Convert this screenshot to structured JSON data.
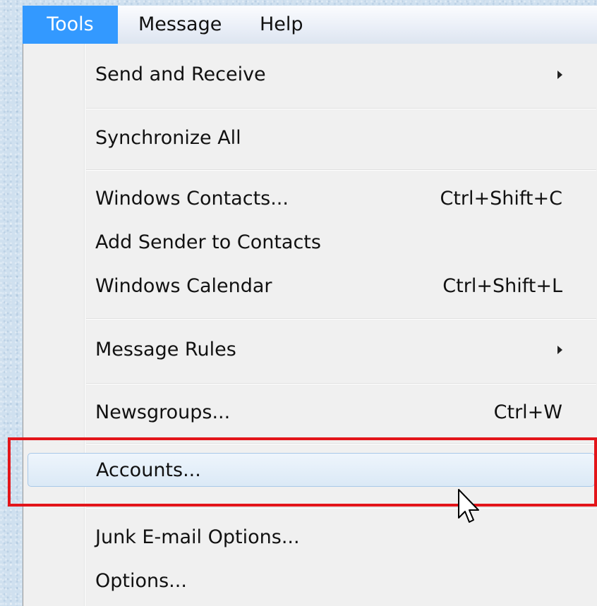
{
  "menubar": {
    "items": [
      {
        "label": "Tools",
        "active": true
      },
      {
        "label": "Message",
        "active": false
      },
      {
        "label": "Help",
        "active": false
      }
    ]
  },
  "tools_menu": {
    "items": [
      {
        "label": "Send and Receive",
        "shortcut": "",
        "submenu": true
      },
      {
        "label": "Synchronize All",
        "shortcut": "",
        "submenu": false
      },
      {
        "label": "Windows Contacts...",
        "shortcut": "Ctrl+Shift+C",
        "submenu": false
      },
      {
        "label": "Add Sender to Contacts",
        "shortcut": "",
        "submenu": false
      },
      {
        "label": "Windows Calendar",
        "shortcut": "Ctrl+Shift+L",
        "submenu": false
      },
      {
        "label": "Message Rules",
        "shortcut": "",
        "submenu": true
      },
      {
        "label": "Newsgroups...",
        "shortcut": "Ctrl+W",
        "submenu": false
      },
      {
        "label": "Accounts...",
        "shortcut": "",
        "submenu": false,
        "highlighted": true
      },
      {
        "label": "Junk E-mail Options...",
        "shortcut": "",
        "submenu": false
      },
      {
        "label": "Options...",
        "shortcut": "",
        "submenu": false
      }
    ]
  },
  "annotation": {
    "color": "#e3151a",
    "target": "Accounts..."
  },
  "icons": {
    "submenu_arrow": "chevron-right-icon",
    "cursor": "mouse-pointer-icon"
  },
  "colors": {
    "menubar_active": "#3399ff",
    "menu_background": "#f0f0f0",
    "highlight": "#dbe9f6"
  }
}
